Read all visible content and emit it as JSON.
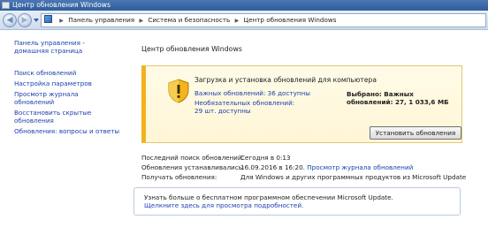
{
  "window": {
    "title": "Центр обновления Windows"
  },
  "addressbar": {
    "crumbs": [
      "Панель управления",
      "Система и безопасность",
      "Центр обновления Windows"
    ]
  },
  "sidebar": {
    "home": "Панель управления - домашняя страница",
    "links": [
      "Поиск обновлений",
      "Настройка параметров",
      "Просмотр журнала обновлений",
      "Восстановить скрытые обновления",
      "Обновления: вопросы и ответы"
    ]
  },
  "main": {
    "title": "Центр обновления Windows",
    "panel": {
      "heading": "Загрузка и установка обновлений для компьютера",
      "important": "Важных обновлений: 36 доступны",
      "optional": "Необязательных обновлений: 29 шт. доступны",
      "selected": "Выбрано: Важных обновлений: 27, 1 033,6 МБ",
      "install_button": "Установить обновления",
      "accent_color": "#f0b21e"
    },
    "info": {
      "last_search_label": "Последний поиск обновлений:",
      "last_search_value": "Сегодня в 0:13",
      "installed_label": "Обновления устанавливались:",
      "installed_value": "16.09.2016 в 16:20.",
      "installed_link": "Просмотр журнала обновлений",
      "receive_label": "Получать обновления:",
      "receive_value": "Для Windows и других программных продуктов из Microsoft Update"
    },
    "msu_box": {
      "line1": "Узнать больше о бесплатном программном обеспечении Microsoft Update.",
      "line2": "Щелкните здесь для просмотра подробностей."
    }
  },
  "icons": {
    "warning_shield": "warning-shield-icon"
  }
}
